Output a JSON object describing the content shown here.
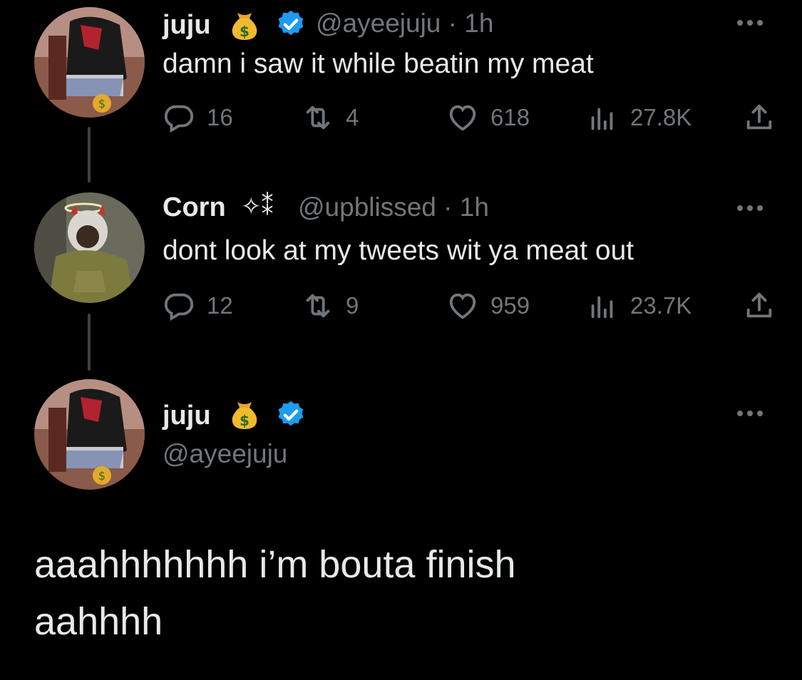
{
  "tweets": [
    {
      "name": "juju",
      "handle": "@ayeejuju · 1h",
      "text": "damn i saw it while beatin my meat",
      "replies": "16",
      "retweets": "4",
      "likes": "618",
      "views": "27.8K"
    },
    {
      "name": "Corn",
      "name_symbols": "✧⁑",
      "handle": "@upblissed · 1h",
      "text": "dont look at my tweets wit ya meat out",
      "replies": "12",
      "retweets": "9",
      "likes": "959",
      "views": "23.7K"
    }
  ],
  "main_tweet": {
    "name": "juju",
    "handle": "@ayeejuju",
    "text_line1": "aaahhhhhhh i’m bouta finish",
    "text_line2": "aahhhh"
  },
  "icons": {
    "money_bag": "money-bag-emoji",
    "verified": "verified-badge",
    "reply": "reply-icon",
    "retweet": "retweet-icon",
    "like": "like-icon",
    "views": "views-icon",
    "share": "share-icon",
    "more": "more-icon"
  },
  "colors": {
    "background": "#000000",
    "text": "#e7e9ea",
    "secondary": "#71767b",
    "verified": "#1d9bf0"
  }
}
